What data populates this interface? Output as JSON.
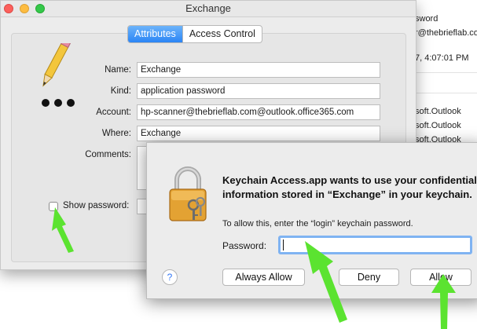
{
  "background_window": {
    "lines": [
      "sword",
      "r@thebrieflab.com",
      "7, 4:07:01 PM",
      "soft.Outlook",
      "soft.Outlook",
      "soft.Outlook"
    ]
  },
  "item_window": {
    "title": "Exchange",
    "tabs": [
      {
        "label": "Attributes",
        "selected": true
      },
      {
        "label": "Access Control",
        "selected": false
      }
    ],
    "fields": {
      "name": {
        "label": "Name:",
        "value": "Exchange"
      },
      "kind": {
        "label": "Kind:",
        "value": "application password"
      },
      "account": {
        "label": "Account:",
        "value": "hp-scanner@thebrieflab.com@outlook.office365.com"
      },
      "where": {
        "label": "Where:",
        "value": "Exchange"
      },
      "comments": {
        "label": "Comments:"
      }
    },
    "show_password": {
      "label": "Show password:",
      "checked": false
    }
  },
  "dialog": {
    "message": "Keychain Access.app wants to use your confidential information stored in “Exchange” in your keychain.",
    "sub_message": "To allow this, enter the “login” keychain password.",
    "password_label": "Password:",
    "password_value": "",
    "buttons": {
      "always_allow": "Always Allow",
      "deny": "Deny",
      "allow": "Allow",
      "help": "?"
    }
  },
  "colors": {
    "accent": "#2a85f5",
    "annotation_arrow": "#5be330",
    "focus_ring": "#7fb3f2"
  },
  "icons": [
    "pencil-icon",
    "lock-keys-icon",
    "help-icon",
    "annotation-arrow"
  ]
}
